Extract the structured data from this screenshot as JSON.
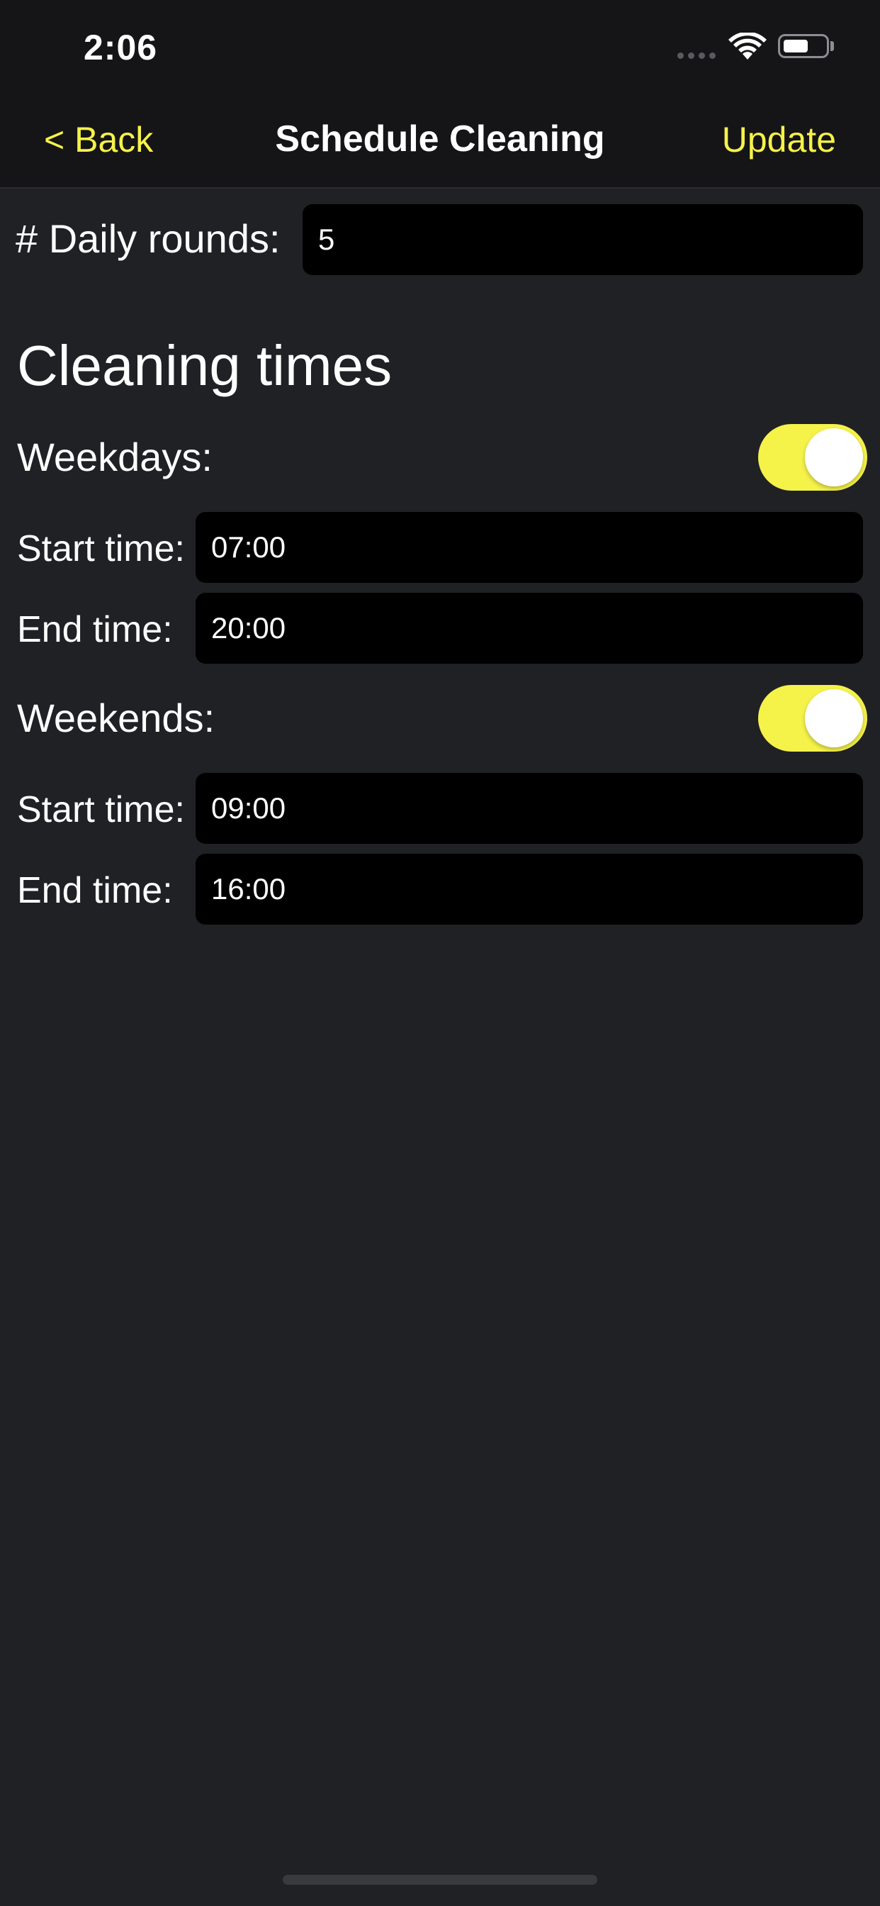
{
  "status_bar": {
    "time": "2:06"
  },
  "nav": {
    "back_label": "< Back",
    "title": "Schedule Cleaning",
    "update_label": "Update"
  },
  "daily_rounds": {
    "label": "# Daily rounds:",
    "value": "5"
  },
  "cleaning_times": {
    "title": "Cleaning times",
    "weekdays": {
      "label": "Weekdays:",
      "enabled": true,
      "start_label": "Start time:",
      "start_value": "07:00",
      "end_label": "End time:",
      "end_value": "20:00"
    },
    "weekends": {
      "label": "Weekends:",
      "enabled": true,
      "start_label": "Start time:",
      "start_value": "09:00",
      "end_label": "End time:",
      "end_value": "16:00"
    }
  },
  "colors": {
    "accent": "#f5f24a",
    "background": "#202125",
    "header": "#151517",
    "field": "#000000"
  }
}
